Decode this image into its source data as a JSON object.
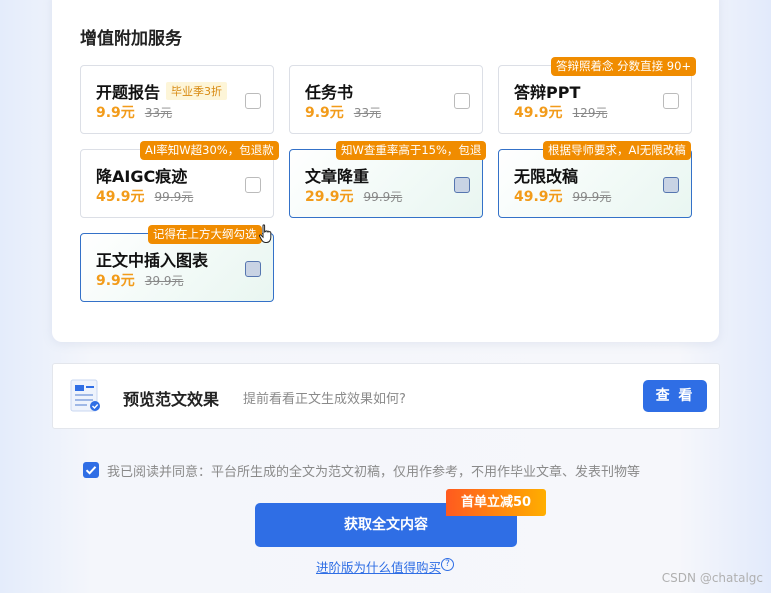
{
  "section_title": "增值附加服务",
  "services": [
    {
      "title": "开题报告",
      "tag": "毕业季3折",
      "price": "9.9元",
      "original": "33元"
    },
    {
      "title": "任务书",
      "price": "9.9元",
      "original": "33元"
    },
    {
      "title": "答辩PPT",
      "price": "49.9元",
      "original": "129元",
      "badge": "答辩照着念 分数直接 90+"
    },
    {
      "title": "降AIGC痕迹",
      "price": "49.9元",
      "original": "99.9元",
      "badge": "AI率知W超30%，包退款"
    },
    {
      "title": "文章降重",
      "price": "29.9元",
      "original": "99.9元",
      "badge": "知W查重率高于15%，包退",
      "selected": true
    },
    {
      "title": "无限改稿",
      "price": "49.9元",
      "original": "99.9元",
      "badge": "根据导师要求，AI无限改稿",
      "selected": true
    },
    {
      "title": "正文中插入图表",
      "price": "9.9元",
      "original": "39.9元",
      "badge": "记得在上方大纲勾选",
      "selected": true
    }
  ],
  "preview": {
    "title": "预览范文效果",
    "hint": "提前看看正文生成效果如何?",
    "button": "查 看"
  },
  "agreement": {
    "checked": true,
    "text": "我已阅读并同意：平台所生成的全文为范文初稿，仅用作参考，不用作毕业文章、发表刊物等"
  },
  "cta": {
    "label": "获取全文内容",
    "promo": "首单立减50"
  },
  "why_link": "进阶版为什么值得购买",
  "watermark": "CSDN @chatalgc",
  "colors": {
    "accent": "#2f6ee5",
    "price": "#f29b1a",
    "badge": "#f08c00"
  },
  "icons": {
    "doc": "document-preview-icon",
    "check": "checkmark-icon",
    "help": "question-circle-icon",
    "cursor": "hand-pointer-icon"
  }
}
